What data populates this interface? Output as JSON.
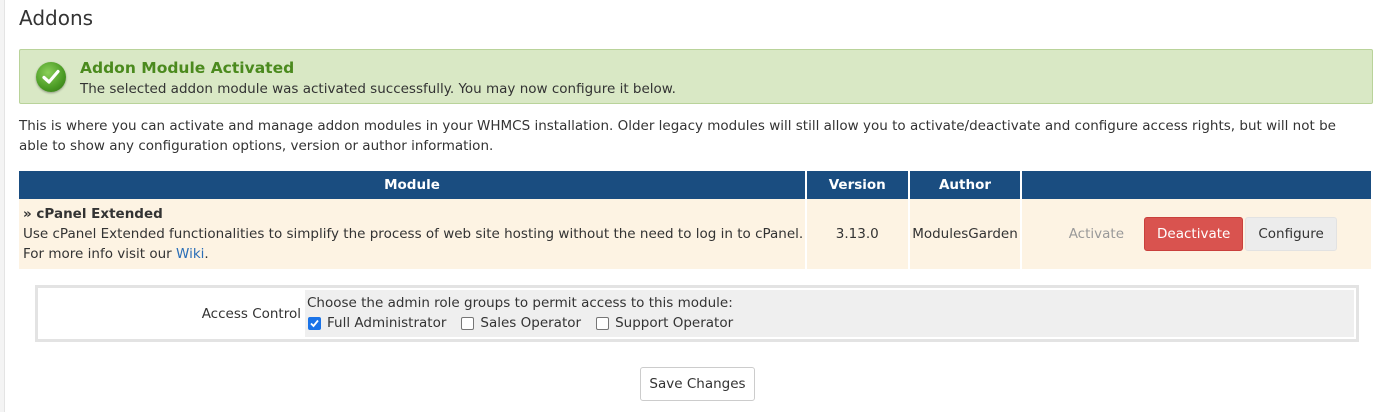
{
  "page": {
    "title": "Addons"
  },
  "alert": {
    "title": "Addon Module Activated",
    "message": "The selected addon module was activated successfully. You may now configure it below.",
    "icon": "check-circle-icon"
  },
  "intro": "This is where you can activate and manage addon modules in your WHMCS installation. Older legacy modules will still allow you to activate/deactivate and configure access rights, but will not be able to show any configuration options, version or author information.",
  "table": {
    "headers": {
      "module": "Module",
      "version": "Version",
      "author": "Author",
      "actions": ""
    },
    "row": {
      "name": "» cPanel Extended",
      "description": "Use cPanel Extended functionalities to simplify the process of web site hosting without the need to log in to cPanel.",
      "more_info_prefix": "For more info visit our ",
      "wiki_link": "Wiki",
      "more_info_suffix": ".",
      "version": "3.13.0",
      "author": "ModulesGarden",
      "activate_label": "Activate",
      "deactivate_label": "Deactivate",
      "configure_label": "Configure"
    }
  },
  "access_control": {
    "label": "Access Control",
    "heading": "Choose the admin role groups to permit access to this module:",
    "roles": [
      {
        "label": "Full Administrator",
        "checked": true
      },
      {
        "label": "Sales Operator",
        "checked": false
      },
      {
        "label": "Support Operator",
        "checked": false
      }
    ]
  },
  "save_label": "Save Changes",
  "colors": {
    "header_bg": "#1a4d80",
    "row_bg": "#fdf3e3",
    "alert_bg": "#d9e8c5",
    "alert_title": "#4b8a1e",
    "deactivate_bg": "#d9534f",
    "link": "#2a6eb7"
  }
}
